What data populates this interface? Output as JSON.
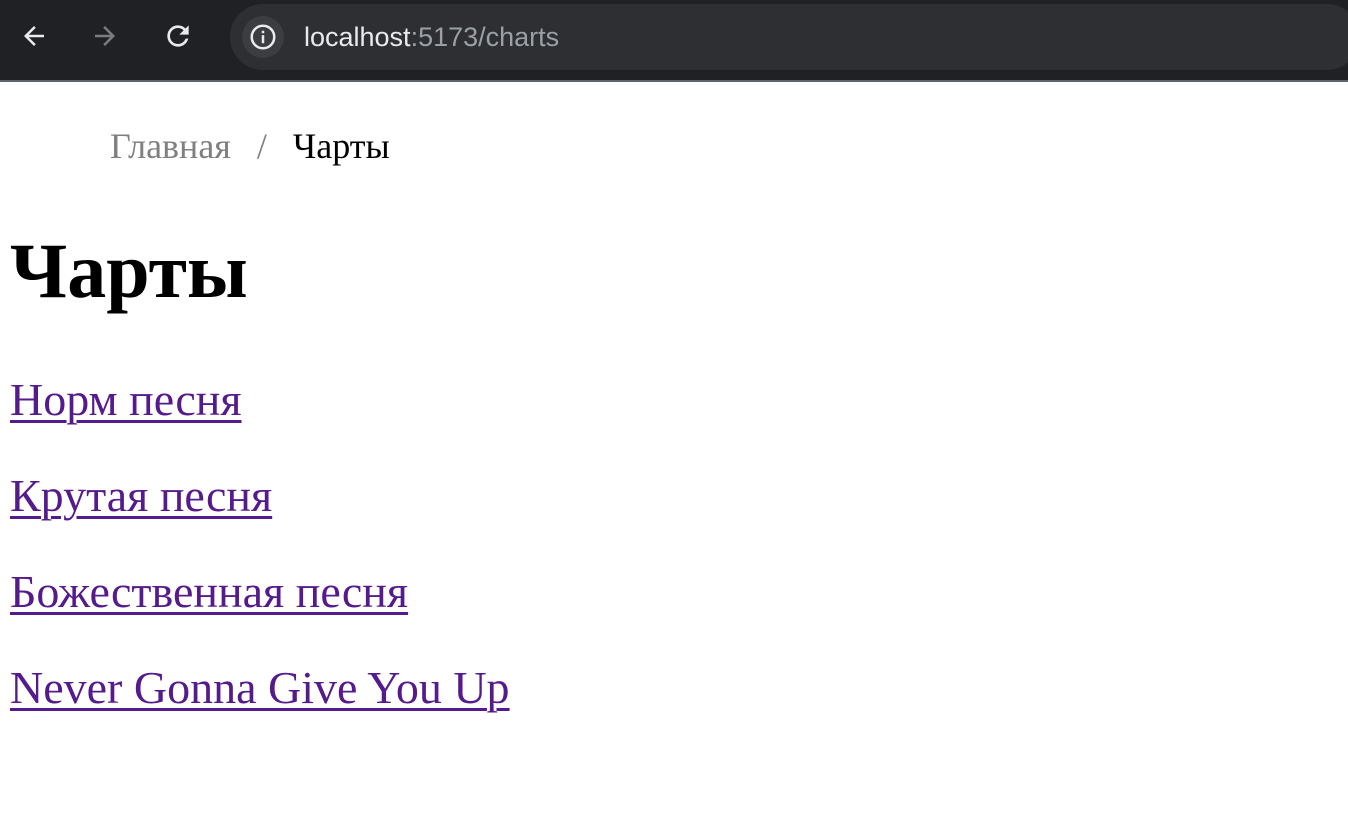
{
  "browser": {
    "url_host": "localhost",
    "url_rest": ":5173/charts"
  },
  "breadcrumb": {
    "home": "Главная",
    "separator": "/",
    "current": "Чарты"
  },
  "page": {
    "title": "Чарты"
  },
  "charts": [
    {
      "label": "Норм песня"
    },
    {
      "label": "Крутая песня"
    },
    {
      "label": "Божественная песня"
    },
    {
      "label": "Never Gonna Give You Up"
    }
  ],
  "colors": {
    "link_visited": "#551a8b",
    "breadcrumb_muted": "#808080",
    "toolbar_bg": "#202124"
  },
  "icons": [
    "back-arrow-icon",
    "forward-arrow-icon",
    "reload-icon",
    "info-icon"
  ]
}
